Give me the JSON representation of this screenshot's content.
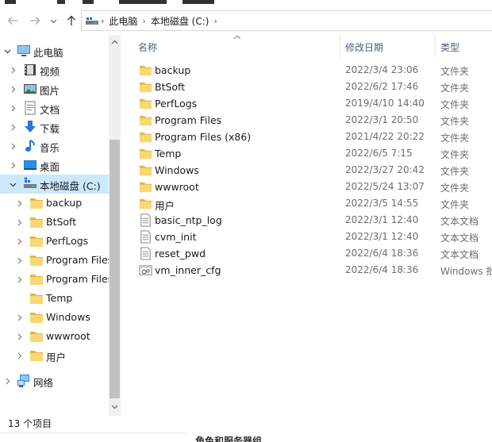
{
  "address": {
    "crumbs": [
      "此电脑",
      "本地磁盘 (C:)"
    ]
  },
  "columns": {
    "name": "名称",
    "modified": "修改日期",
    "type": "类型"
  },
  "tree": [
    {
      "label": "此电脑",
      "icon": "this-pc-icon"
    },
    {
      "label": "视频",
      "icon": "video-folder-icon"
    },
    {
      "label": "图片",
      "icon": "pictures-folder-icon"
    },
    {
      "label": "文档",
      "icon": "documents-folder-icon"
    },
    {
      "label": "下载",
      "icon": "downloads-folder-icon"
    },
    {
      "label": "音乐",
      "icon": "music-folder-icon"
    },
    {
      "label": "桌面",
      "icon": "desktop-folder-icon"
    },
    {
      "label": "本地磁盘 (C:)",
      "icon": "local-disk-icon"
    },
    {
      "label": "backup",
      "icon": "folder-icon"
    },
    {
      "label": "BtSoft",
      "icon": "folder-icon"
    },
    {
      "label": "PerfLogs",
      "icon": "folder-icon"
    },
    {
      "label": "Program Files",
      "icon": "folder-icon"
    },
    {
      "label": "Program Files",
      "icon": "folder-icon"
    },
    {
      "label": "Temp",
      "icon": "folder-icon"
    },
    {
      "label": "Windows",
      "icon": "folder-icon"
    },
    {
      "label": "wwwroot",
      "icon": "folder-icon"
    },
    {
      "label": "用户",
      "icon": "folder-icon"
    },
    {
      "label": "网络",
      "icon": "network-icon"
    }
  ],
  "files": [
    {
      "name": "backup",
      "date": "2022/3/4 23:06",
      "type": "文件夹",
      "icon": "folder-icon"
    },
    {
      "name": "BtSoft",
      "date": "2022/6/2 17:46",
      "type": "文件夹",
      "icon": "folder-icon"
    },
    {
      "name": "PerfLogs",
      "date": "2019/4/10 14:40",
      "type": "文件夹",
      "icon": "folder-icon"
    },
    {
      "name": "Program Files",
      "date": "2022/3/1 20:50",
      "type": "文件夹",
      "icon": "folder-icon"
    },
    {
      "name": "Program Files (x86)",
      "date": "2021/4/22 20:22",
      "type": "文件夹",
      "icon": "folder-icon"
    },
    {
      "name": "Temp",
      "date": "2022/6/5 7:15",
      "type": "文件夹",
      "icon": "folder-icon"
    },
    {
      "name": "Windows",
      "date": "2022/3/27 20:42",
      "type": "文件夹",
      "icon": "folder-icon"
    },
    {
      "name": "wwwroot",
      "date": "2022/5/24 13:07",
      "type": "文件夹",
      "icon": "folder-icon"
    },
    {
      "name": "用户",
      "date": "2022/3/5 14:55",
      "type": "文件夹",
      "icon": "folder-icon"
    },
    {
      "name": "basic_ntp_log",
      "date": "2022/3/1 12:40",
      "type": "文本文档",
      "icon": "text-file-icon"
    },
    {
      "name": "cvm_init",
      "date": "2022/3/1 12:40",
      "type": "文本文档",
      "icon": "text-file-icon"
    },
    {
      "name": "reset_pwd",
      "date": "2022/6/4 18:36",
      "type": "文本文档",
      "icon": "text-file-icon"
    },
    {
      "name": "vm_inner_cfg",
      "date": "2022/6/4 18:36",
      "type": "Windows 批",
      "icon": "batch-file-icon"
    }
  ],
  "status": {
    "item_count": "13 个项目"
  },
  "background_window": {
    "text": "角色和服务器组"
  },
  "colors": {
    "folder": "#f8d775",
    "selection": "#cce8ff",
    "header_text": "#4c607a"
  }
}
